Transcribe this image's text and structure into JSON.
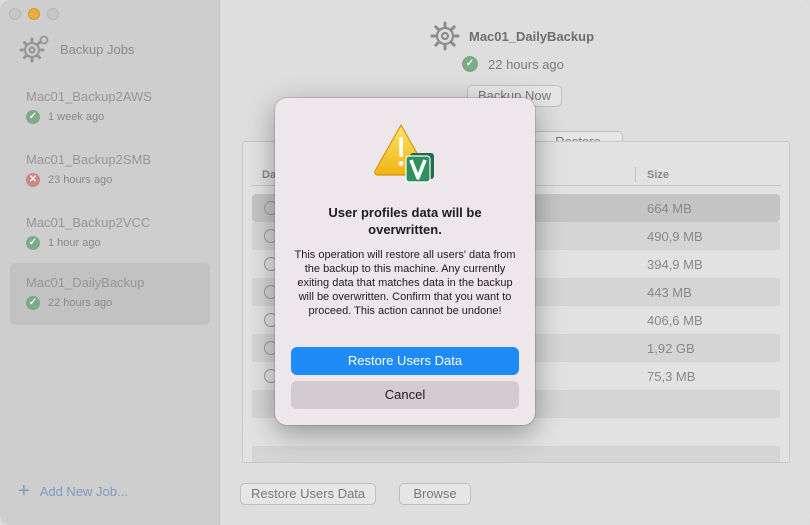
{
  "sidebar": {
    "header": "Backup Jobs",
    "jobs": [
      {
        "name": "Mac01_Backup2AWS",
        "status": "1 week ago",
        "state": "ok"
      },
      {
        "name": "Mac01_Backup2SMB",
        "status": "23 hours ago",
        "state": "error"
      },
      {
        "name": "Mac01_Backup2VCC",
        "status": "1 hour ago",
        "state": "ok"
      },
      {
        "name": "Mac01_DailyBackup",
        "status": "22 hours ago",
        "state": "ok",
        "selected": true
      }
    ],
    "add_job": "Add New Job..."
  },
  "main": {
    "job_title": "Mac01_DailyBackup",
    "job_status": "22 hours ago",
    "backup_now": "Backup Now",
    "restore_tab": "Restore",
    "table": {
      "col1": "Da",
      "col2": "Size",
      "rows": [
        "664 MB",
        "490,9 MB",
        "394,9 MB",
        "443 MB",
        "406,6 MB",
        "1,92 GB",
        "75,3 MB"
      ]
    },
    "restore_users_data": "Restore Users Data",
    "browse": "Browse"
  },
  "dialog": {
    "title": "User profiles data will be overwritten.",
    "body": "This operation will restore all users' data from the backup to this machine. Any currently exiting data that matches data in the backup will be overwritten. Confirm that you want to proceed. This action cannot be undone!",
    "primary_button": "Restore Users Data",
    "secondary_button": "Cancel",
    "icon": "warning-veeam-icon"
  },
  "colors": {
    "accent": "#1f8bf6",
    "ok": "#7eb08a",
    "error": "#d08a86",
    "warning": "#f5c518"
  }
}
